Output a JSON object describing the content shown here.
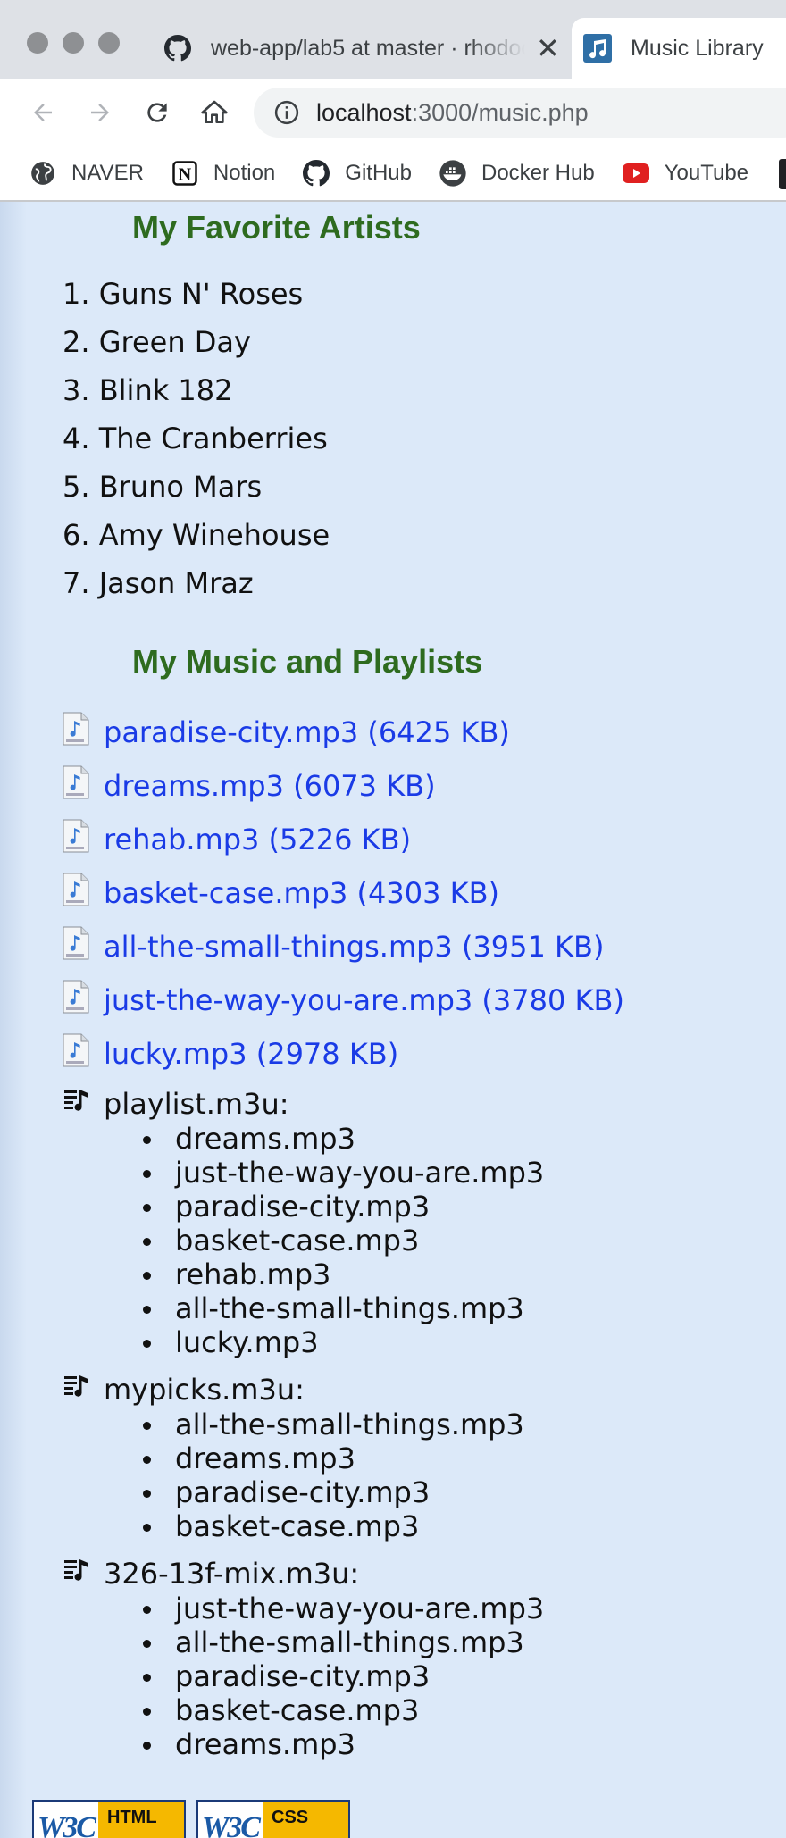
{
  "tabs": [
    {
      "title": "web-app/lab5 at master · rhodoc",
      "favicon": "github-icon",
      "active": false
    },
    {
      "title": "Music Library",
      "favicon": "music-note-icon",
      "active": true
    }
  ],
  "toolbar": {
    "url_host": "localhost",
    "url_path": ":3000/music.php"
  },
  "bookmarks": [
    {
      "label": "NAVER",
      "icon": "globe-icon"
    },
    {
      "label": "Notion",
      "icon": "notion-icon"
    },
    {
      "label": "GitHub",
      "icon": "github-icon"
    },
    {
      "label": "Docker Hub",
      "icon": "docker-icon"
    },
    {
      "label": "YouTube",
      "icon": "youtube-icon"
    }
  ],
  "page": {
    "artists_heading": "My Favorite Artists",
    "artists": [
      {
        "num": "1.",
        "name": "Guns N' Roses"
      },
      {
        "num": "2.",
        "name": "Green Day"
      },
      {
        "num": "3.",
        "name": "Blink 182"
      },
      {
        "num": "4.",
        "name": "The Cranberries"
      },
      {
        "num": "5.",
        "name": "Bruno Mars"
      },
      {
        "num": "6.",
        "name": "Amy Winehouse"
      },
      {
        "num": "7.",
        "name": "Jason Mraz"
      }
    ],
    "music_heading": "My Music and Playlists",
    "songs": [
      "paradise-city.mp3 (6425 KB)",
      "dreams.mp3 (6073 KB)",
      "rehab.mp3 (5226 KB)",
      "basket-case.mp3 (4303 KB)",
      "all-the-small-things.mp3 (3951 KB)",
      "just-the-way-you-are.mp3 (3780 KB)",
      "lucky.mp3 (2978 KB)"
    ],
    "playlists": [
      {
        "name": "playlist.m3u:",
        "items": [
          "dreams.mp3",
          "just-the-way-you-are.mp3",
          "paradise-city.mp3",
          "basket-case.mp3",
          "rehab.mp3",
          "all-the-small-things.mp3",
          "lucky.mp3"
        ]
      },
      {
        "name": "mypicks.m3u:",
        "items": [
          "all-the-small-things.mp3",
          "dreams.mp3",
          "paradise-city.mp3",
          "basket-case.mp3"
        ]
      },
      {
        "name": "326-13f-mix.m3u:",
        "items": [
          "just-the-way-you-are.mp3",
          "all-the-small-things.mp3",
          "paradise-city.mp3",
          "basket-case.mp3",
          "dreams.mp3"
        ]
      }
    ],
    "badges": [
      {
        "logo": "W3C",
        "label": "HTML"
      },
      {
        "logo": "W3C",
        "label": "CSS"
      }
    ]
  },
  "colors": {
    "heading": "#2e6b1f",
    "link": "#1a3be6",
    "page_bg": "#dce9f9"
  }
}
